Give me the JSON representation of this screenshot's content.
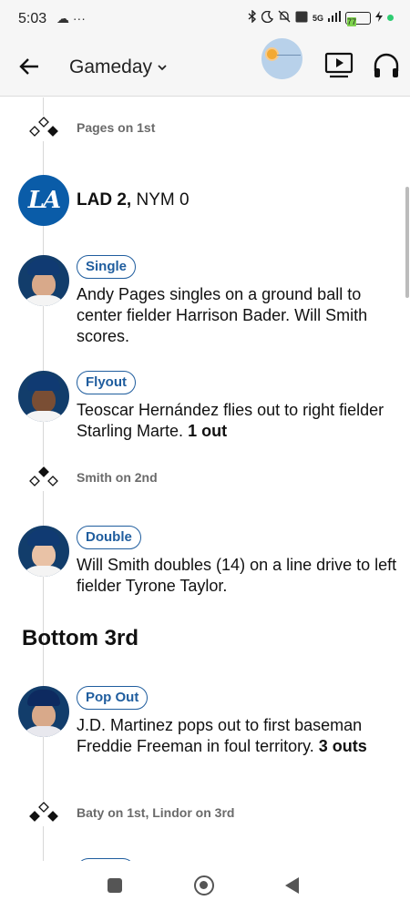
{
  "status_bar": {
    "time": "5:03",
    "left_icons": "☁ ···",
    "network": "5G",
    "battery": "77"
  },
  "header": {
    "title": "Gameday",
    "back_icon": "arrow-left-icon",
    "tv_icon": "tv-play-icon",
    "audio_icon": "headphones-icon"
  },
  "feed": {
    "base_states": [
      {
        "text": "Pages on 1st",
        "first": true,
        "second": false,
        "third": false
      },
      {
        "text": "Smith on 2nd",
        "first": false,
        "second": true,
        "third": false
      },
      {
        "text": "Baty on 1st, Lindor on 3rd",
        "first": true,
        "second": false,
        "third": true
      }
    ],
    "score": {
      "team_logo": "LA",
      "lad": "LAD 2,",
      "nym": "NYM 0"
    },
    "plays": [
      {
        "badge": "Single",
        "desc": "Andy Pages singles on a ground ball to center fielder Harrison Bader. Will Smith scores.",
        "outs": ""
      },
      {
        "badge": "Flyout",
        "desc": "Teoscar Hernández flies out to right fielder Starling Marte.",
        "outs": "1 out"
      },
      {
        "badge": "Double",
        "desc": "Will Smith doubles (14) on a line drive to left fielder Tyrone Taylor.",
        "outs": ""
      },
      {
        "badge": "Pop Out",
        "desc": "J.D. Martinez pops out to first baseman Freddie Freeman in foul territory.",
        "outs": "3 outs"
      }
    ],
    "inning_header": "Bottom 3rd"
  },
  "colors": {
    "accent": "#1f5d9e",
    "dodgers_blue": "#0a5ca8",
    "header_bg": "#f6f6f6"
  }
}
